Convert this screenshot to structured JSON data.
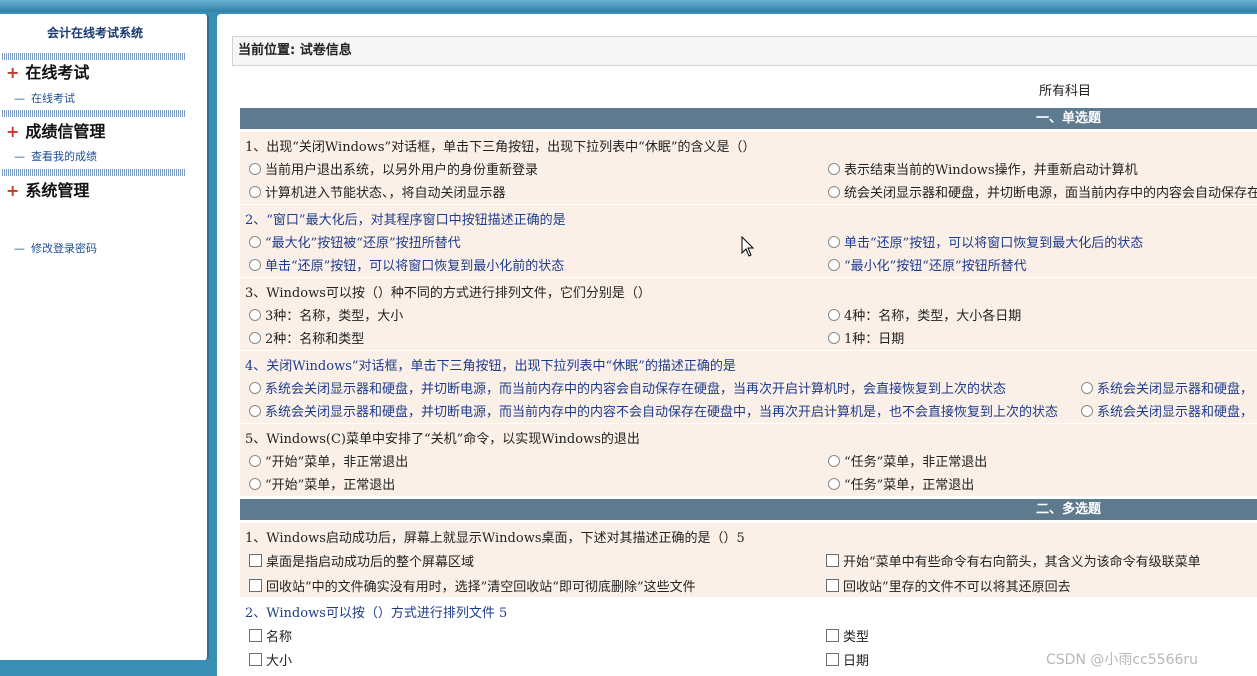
{
  "sidebar": {
    "title": "会计在线考试系统",
    "groups": [
      {
        "label": "在线考试",
        "link": "在线考试"
      },
      {
        "label": "成绩信管理",
        "link": "查看我的成绩"
      },
      {
        "label": "系统管理",
        "link": "修改登录密码"
      }
    ]
  },
  "breadcrumb": "当前位置: 试卷信息",
  "subject": "所有科目",
  "sections": {
    "single": "一、单选题",
    "multi": "二、多选题"
  },
  "single_questions": [
    {
      "q": "1、出现“关闭Windows”对话框，单击下三角按钮，出现下拉列表中“休眠”的含义是（）",
      "options": [
        "当前用户退出系统，以另外用户的身份重新登录",
        "表示结束当前的Windows操作，并重新启动计算机",
        "计算机进入节能状态、，将自动关闭显示器",
        "统会关闭显示器和硬盘，并切断电源，面当前内存中的内容会自动保存在"
      ]
    },
    {
      "q": "2、“窗口”最大化后，对其程序窗口中按钮描述正确的是",
      "options": [
        "“最大化”按钮被“还原”按扭所替代",
        "单击“还原”按钮，可以将窗口恢复到最大化后的状态",
        "单击“还原”按钮，可以将窗口恢复到最小化前的状态",
        "“最小化”按钮“还原”按钮所替代"
      ]
    },
    {
      "q": "3、Windows可以按（）种不同的方式进行排列文件，它们分别是（）",
      "options": [
        "3种：名称，类型，大小",
        "4种：名称，类型，大小各日期",
        "2种：名称和类型",
        "1种：日期"
      ]
    },
    {
      "q": "4、关闭Windows”对话框，单击下三角按钮，出现下拉列表中“休眠”的描述正确的是",
      "options": [
        "系统会关闭显示器和硬盘，并切断电源，而当前内存中的内容会自动保存在硬盘，当再次开启计算机时，会直接恢复到上次的状态",
        "系统会关闭显示器和硬盘，",
        "系统会关闭显示器和硬盘，并切断电源，而当前内存中的内容不会自动保存在硬盘中，当再次开启计算机是，也不会直接恢复到上次的状态",
        "系统会关闭显示器和硬盘，"
      ]
    },
    {
      "q": "5、Windows(C)菜单中安排了“关机”命令，以实现Windows的退出",
      "options": [
        "“开始”菜单，非正常退出",
        "“任务”菜单，非正常退出",
        "“开始”菜单，正常退出",
        "“任务”菜单，正常退出"
      ]
    }
  ],
  "multi_questions": [
    {
      "q": "1、Windows启动成功后，屏幕上就显示Windows桌面，下述对其描述正确的是（）5",
      "options": [
        "桌面是指启动成功后的整个屏幕区域",
        "开始“菜单中有些命令有右向箭头，其含义为该命令有级联菜单",
        "回收站”中的文件确实没有用时，选择”清空回收站“即可彻底删除”这些文件",
        "回收站”里存的文件不可以将其还原回去"
      ]
    },
    {
      "q": "2、Windows可以按（）方式进行排列文件 5",
      "options": [
        "名称",
        "类型",
        "大小",
        "日期"
      ]
    }
  ],
  "watermark": "CSDN @小雨cc5566ru"
}
